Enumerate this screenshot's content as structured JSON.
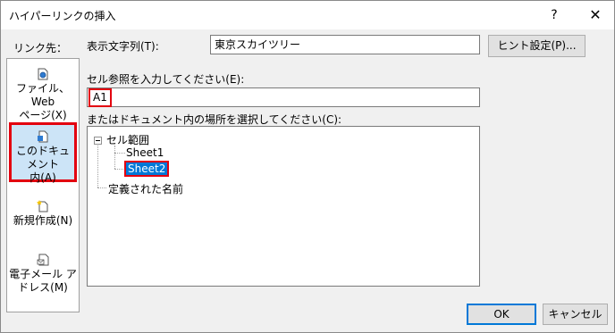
{
  "window": {
    "title": "ハイパーリンクの挿入",
    "help": "?",
    "close": "✕"
  },
  "link_to": {
    "label": "リンク先：",
    "items": [
      {
        "line1": "ファイル、Web",
        "line2": "ページ(X)",
        "icon": "web-page-icon"
      },
      {
        "line1": "このドキュメント",
        "line2": "内(A)",
        "icon": "document-icon",
        "selected": true
      },
      {
        "line1": "新規作成(N)",
        "line2": "",
        "icon": "new-document-icon"
      },
      {
        "line1": "電子メール ア",
        "line2": "ドレス(M)",
        "icon": "email-icon"
      }
    ]
  },
  "display_text": {
    "label": "表示文字列(T):",
    "value": "東京スカイツリー"
  },
  "hint_button": "ヒント設定(P)...",
  "cell_ref": {
    "label": "セル参照を入力してください(E):",
    "value": "A1"
  },
  "location": {
    "label": "またはドキュメント内の場所を選択してください(C):",
    "tree": {
      "root": "セル範囲",
      "sheets": [
        "Sheet1",
        "Sheet2"
      ],
      "selected": "Sheet2",
      "defined_names": "定義された名前"
    }
  },
  "ok_button": "OK",
  "cancel_button": "キャンセル"
}
